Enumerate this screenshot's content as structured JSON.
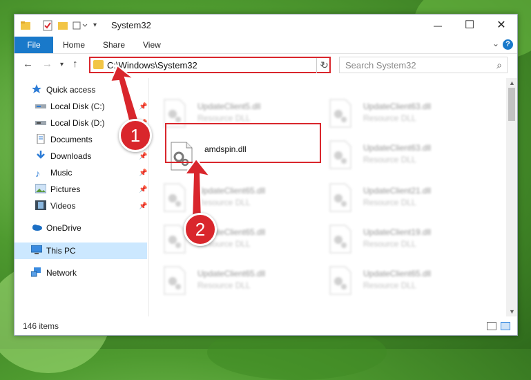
{
  "window": {
    "title": "System32",
    "minimize_glyph": "—",
    "maximize_glyph": "☐",
    "close_glyph": "✕"
  },
  "ribbon": {
    "tabs": [
      "File",
      "Home",
      "Share",
      "View"
    ],
    "help_glyph": "?"
  },
  "address": {
    "path": "C:\\Windows\\System32",
    "search_placeholder": "Search System32"
  },
  "sidebar": {
    "items": [
      {
        "label": "Quick access",
        "icon": "star-icon"
      },
      {
        "label": "Local Disk (C:)",
        "icon": "drive-icon",
        "pinned": true
      },
      {
        "label": "Local Disk (D:)",
        "icon": "drive-icon",
        "pinned": true
      },
      {
        "label": "Documents",
        "icon": "documents-icon",
        "pinned": true
      },
      {
        "label": "Downloads",
        "icon": "download-icon",
        "pinned": true
      },
      {
        "label": "Music",
        "icon": "music-icon",
        "pinned": true
      },
      {
        "label": "Pictures",
        "icon": "pictures-icon",
        "pinned": true
      },
      {
        "label": "Videos",
        "icon": "videos-icon",
        "pinned": true
      },
      {
        "label": "OneDrive",
        "icon": "cloud-icon"
      },
      {
        "label": "This PC",
        "icon": "computer-icon",
        "selected": true
      },
      {
        "label": "Network",
        "icon": "network-icon"
      }
    ]
  },
  "files": {
    "highlighted": {
      "name": "amdspin.dll"
    },
    "left_column": [
      {
        "name": "UpdateClient5.dll",
        "type": "Resource DLL"
      },
      {
        "name": "UpdateClient65.dll",
        "type": "Resource DLL"
      },
      {
        "name": "UpdateClient65.dll",
        "type": "Resource DLL"
      },
      {
        "name": "UpdateClient65.dll",
        "type": "Resource DLL"
      }
    ],
    "right_column": [
      {
        "name": "UpdateClient63.dll",
        "type": "Resource DLL"
      },
      {
        "name": "UpdateClient63.dll",
        "type": "Resource DLL"
      },
      {
        "name": "UpdateClient21.dll",
        "type": "Resource DLL"
      },
      {
        "name": "UpdateClient19.dll",
        "type": "Resource DLL"
      },
      {
        "name": "UpdateClient65.dll",
        "type": "Resource DLL"
      }
    ]
  },
  "status": {
    "item_count": "146 items"
  },
  "annotations": {
    "step1": "1",
    "step2": "2",
    "color": "#d9262c"
  }
}
